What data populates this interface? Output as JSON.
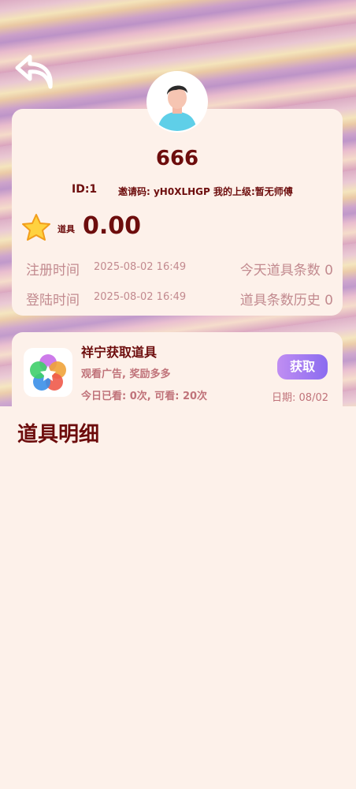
{
  "profile": {
    "username": "666",
    "id_text": "ID:1",
    "invite_text": "邀请码: yH0XLHGP  我的上级:暂无师傅",
    "prop_label": "道具",
    "prop_value": "0.00",
    "register_label": "注册时间",
    "register_time": "2025-08-02 16:49",
    "today_label": "今天道具条数",
    "today_value": "0",
    "login_label": "登陆时间",
    "login_time": "2025-08-02 16:49",
    "history_label": "道具条数历史",
    "history_value": "0"
  },
  "task": {
    "title": "祥宁获取道具",
    "subtitle": "观看广告, 奖励多多",
    "count_text": "今日已看: 0次, 可看: 20次",
    "button_label": "获取",
    "date_text": "日期: 08/02"
  },
  "section": {
    "title": "道具明细"
  },
  "colors": {
    "text_dark": "#6d0d0d",
    "text_muted": "#c28a8f",
    "button_start": "#c08ef2",
    "button_end": "#8a6bf0",
    "card_bg": "#fdf1ea"
  },
  "icons": [
    "back-arrow-icon",
    "avatar-icon",
    "star-icon",
    "app-icon"
  ]
}
